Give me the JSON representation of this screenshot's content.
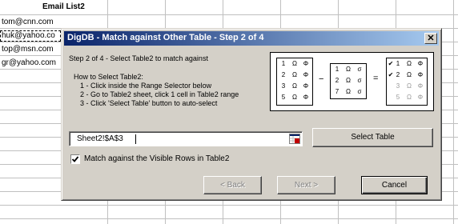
{
  "sheet": {
    "column_header": "Email List2",
    "cells": [
      "tom@cnn.com",
      "huk@yahoo.co",
      "top@msn.com",
      "gr@yahoo.com"
    ]
  },
  "dialog": {
    "title": "DigDB - Match against Other Table - Step 2 of 4",
    "close_label": "✕",
    "step_label": "Step 2 of 4 - Select Table2 to match against",
    "howto_title": "How to Select Table2:",
    "howto_steps": [
      "1 - Click inside the Range Selector below",
      "2 - Go to Table2 sheet, click 1 cell in Table2 range",
      "3 - Click 'Select Table' button to auto-select"
    ],
    "range_value": "Sheet2!$A$3",
    "select_table_label": "Select Table",
    "checkbox_label": "Match against the Visible Rows in Table2",
    "checkbox_checked": true,
    "back_label": "< Back",
    "next_label": "Next >",
    "cancel_label": "Cancel",
    "diagram": {
      "minus": "−",
      "equals": "=",
      "table1": [
        [
          "1",
          "Ω",
          "Φ"
        ],
        [
          "2",
          "Ω",
          "Φ"
        ],
        [
          "3",
          "Ω",
          "Φ"
        ],
        [
          "5",
          "Ω",
          "Φ"
        ]
      ],
      "table2": [
        [
          "1",
          "Ω",
          "σ"
        ],
        [
          "2",
          "Ω",
          "σ"
        ],
        [
          "7",
          "Ω",
          "σ"
        ]
      ],
      "result": [
        [
          "1",
          "Ω",
          "Φ"
        ],
        [
          "2",
          "Ω",
          "Φ"
        ],
        [
          "3",
          "Ω",
          "Φ"
        ],
        [
          "5",
          "Ω",
          "Φ"
        ]
      ],
      "result_checks": [
        true,
        true,
        false,
        false
      ]
    }
  }
}
